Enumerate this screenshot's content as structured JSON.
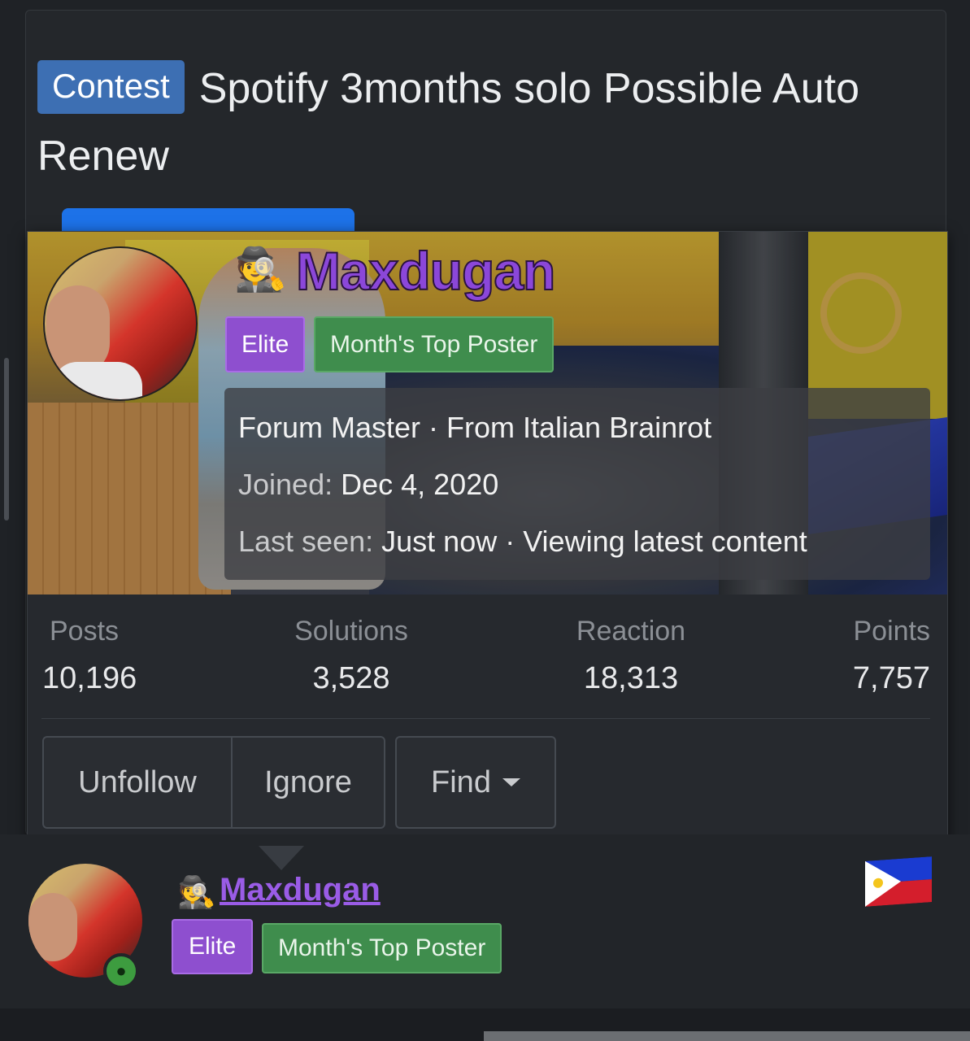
{
  "thread": {
    "prefix": "Contest",
    "title": "Spotify 3months solo Possible Auto Renew"
  },
  "member_card": {
    "username": "Maxdugan",
    "badges": {
      "elite": "Elite",
      "top_poster": "Month's Top Poster"
    },
    "info": {
      "title_line": "Forum Master · From Italian Brainrot",
      "joined_label": "Joined:",
      "joined_value": "Dec 4, 2020",
      "last_seen_label": "Last seen:",
      "last_seen_value": "Just now · Viewing latest content"
    },
    "stats": [
      {
        "label": "Posts",
        "value": "10,196"
      },
      {
        "label": "Solutions",
        "value": "3,528"
      },
      {
        "label": "Reaction",
        "value": "18,313"
      },
      {
        "label": "Points",
        "value": "7,757"
      }
    ],
    "buttons": {
      "unfollow": "Unfollow",
      "ignore": "Ignore",
      "find": "Find"
    }
  },
  "post_author": {
    "username": "Maxdugan",
    "badges": {
      "elite": "Elite",
      "top_poster": "Month's Top Poster"
    },
    "status": "online",
    "flag": "philippines-flag-icon"
  },
  "icons": {
    "user_icon": "detective-icon",
    "online": "user-circle-icon"
  },
  "colors": {
    "accent_purple": "#8b47d9",
    "elite": "#8e4fcf",
    "top_poster": "#3f8d4d",
    "prefix": "#3d6fb3"
  }
}
